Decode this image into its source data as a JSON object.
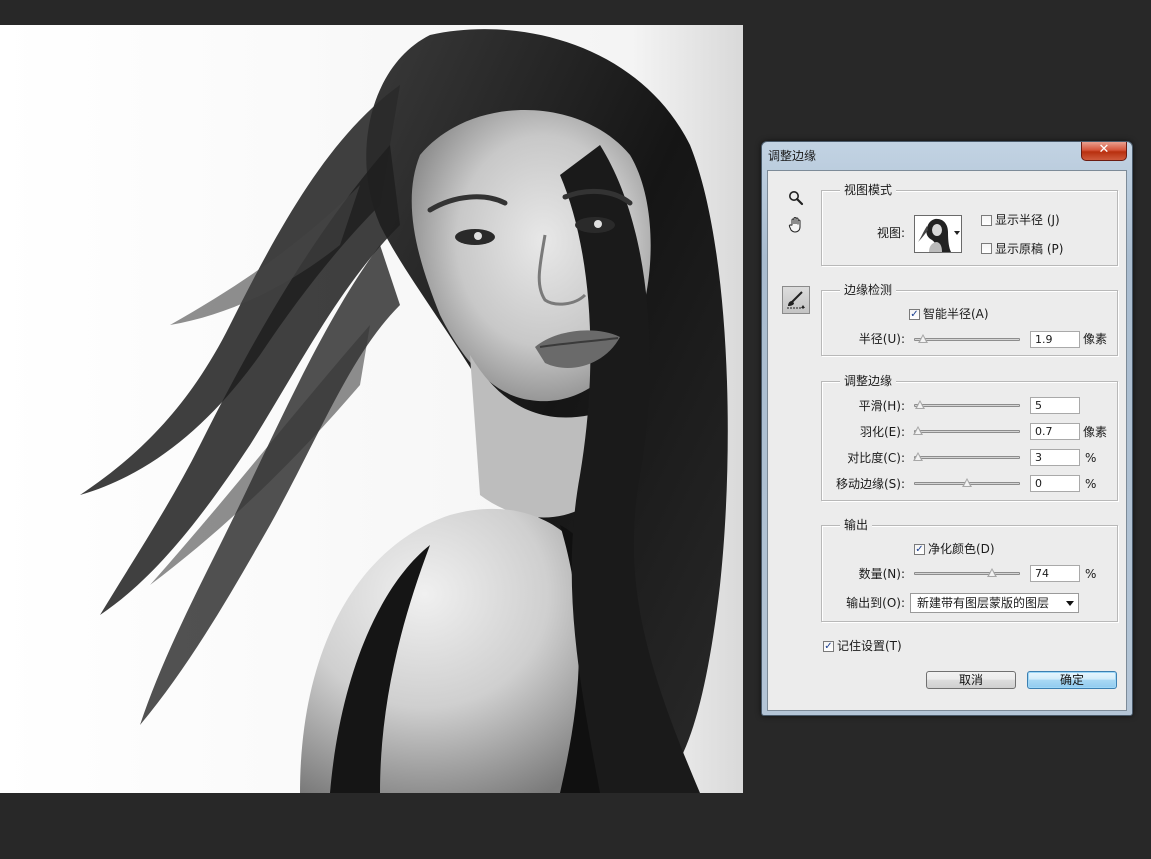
{
  "dialog": {
    "title": "调整边缘",
    "close_symbol": "✕"
  },
  "tools": {
    "zoom_icon": "zoom-icon",
    "hand_icon": "hand-icon",
    "refine_brush_icon": "refine-radius-brush-icon"
  },
  "view_mode": {
    "legend": "视图模式",
    "view_label": "视图:",
    "show_radius": {
      "label": "显示半径 (J)",
      "checked": false
    },
    "show_original": {
      "label": "显示原稿 (P)",
      "checked": false
    }
  },
  "edge_detection": {
    "legend": "边缘检测",
    "smart_radius": {
      "label": "智能半径(A)",
      "checked": true
    },
    "radius": {
      "label": "半径(U):",
      "value": "1.9",
      "unit": "像素",
      "slider_fraction": 0.08
    }
  },
  "adjust_edge": {
    "legend": "调整边缘",
    "smooth": {
      "label": "平滑(H):",
      "value": "5",
      "unit": "",
      "slider_fraction": 0.05
    },
    "feather": {
      "label": "羽化(E):",
      "value": "0.7",
      "unit": "像素",
      "slider_fraction": 0.03
    },
    "contrast": {
      "label": "对比度(C):",
      "value": "3",
      "unit": "%",
      "slider_fraction": 0.03
    },
    "shift_edge": {
      "label": "移动边缘(S):",
      "value": "0",
      "unit": "%",
      "slider_fraction": 0.5
    }
  },
  "output": {
    "legend": "输出",
    "decontaminate": {
      "label": "净化颜色(D)",
      "checked": true
    },
    "amount": {
      "label": "数量(N):",
      "value": "74",
      "unit": "%",
      "slider_fraction": 0.74
    },
    "output_to": {
      "label": "输出到(O):",
      "selected": "新建带有图层蒙版的图层"
    }
  },
  "remember": {
    "label": "记住设置(T)",
    "checked": true
  },
  "buttons": {
    "cancel": "取消",
    "ok": "确定"
  }
}
